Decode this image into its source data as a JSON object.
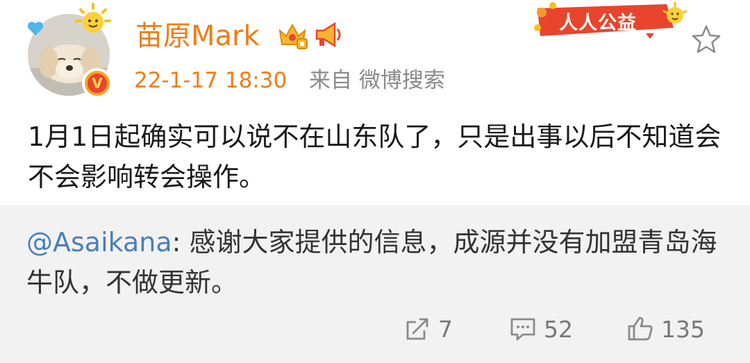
{
  "post": {
    "username": "苗原Mark",
    "timestamp": "22-1-17 18:30",
    "source": "来自 微博搜索",
    "content": "1月1日起确实可以说不在山东队了，只是出事以后不知道会不会影响转会操作。",
    "charity_label": "人人公益",
    "verify_mark": "V"
  },
  "repost": {
    "mention": "@Asaikana",
    "text": ": 感谢大家提供的信息，成源并没有加盟青岛海牛队，不做更新。",
    "actions": {
      "share_count": "7",
      "comment_count": "52",
      "like_count": "135"
    }
  },
  "icons": [
    "avatar",
    "sun-badge-icon",
    "heart-icon",
    "verified-icon",
    "crown-icon",
    "megaphone-icon",
    "star-icon",
    "share-icon",
    "comment-icon",
    "like-icon"
  ],
  "colors": {
    "username": "#f07c14",
    "meta": "#8a8a8a",
    "mention": "#4a7fb8",
    "repost_bg": "#f2f2f2",
    "charity": "#e8452c"
  }
}
